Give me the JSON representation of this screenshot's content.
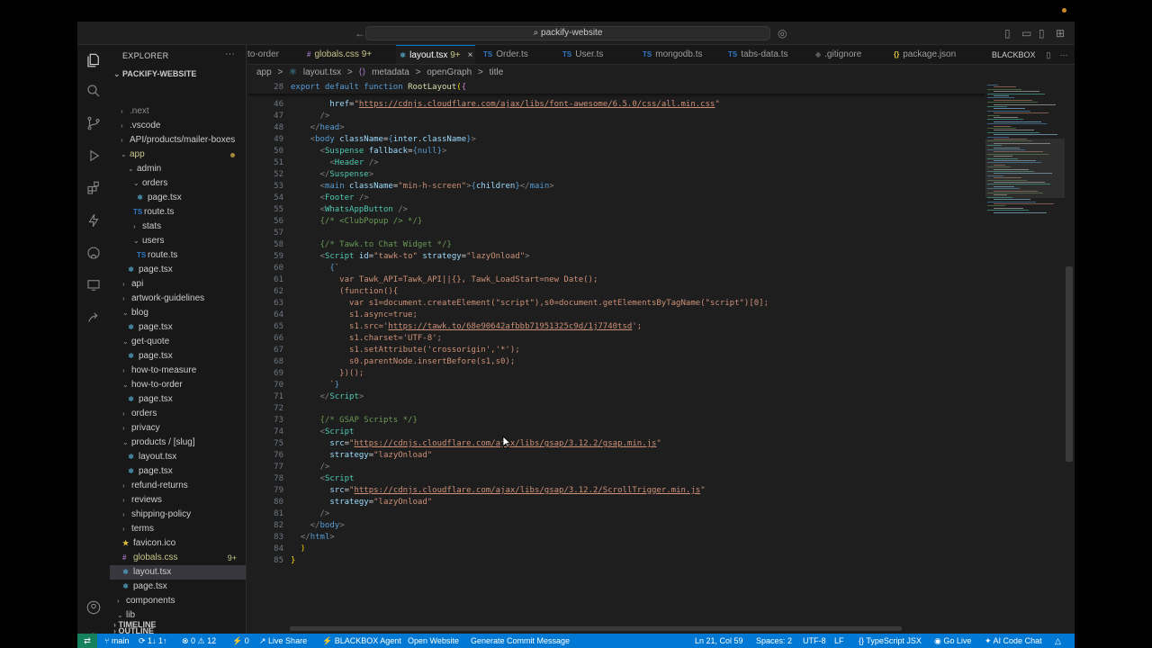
{
  "window": {
    "search": "packify-website",
    "nav_back": "←",
    "nav_fwd": "→"
  },
  "explorer": {
    "title": "EXPLORER",
    "more": "···",
    "root": "PACKIFY-WEBSITE",
    "items": [
      {
        "label": ".next"
      },
      {
        "label": ".vscode"
      },
      {
        "label": "API/products/mailer-boxes"
      },
      {
        "label": "app"
      },
      {
        "label": "admin"
      },
      {
        "label": "orders"
      },
      {
        "label": "page.tsx"
      },
      {
        "label": "route.ts"
      },
      {
        "label": "stats"
      },
      {
        "label": "users"
      },
      {
        "label": "route.ts"
      },
      {
        "label": "page.tsx"
      },
      {
        "label": "api"
      },
      {
        "label": "artwork-guidelines"
      },
      {
        "label": "blog"
      },
      {
        "label": "page.tsx"
      },
      {
        "label": "get-quote"
      },
      {
        "label": "page.tsx"
      },
      {
        "label": "how-to-measure"
      },
      {
        "label": "how-to-order"
      },
      {
        "label": "page.tsx"
      },
      {
        "label": "orders"
      },
      {
        "label": "privacy"
      },
      {
        "label": "products / [slug]"
      },
      {
        "label": "layout.tsx"
      },
      {
        "label": "page.tsx"
      },
      {
        "label": "refund-returns"
      },
      {
        "label": "reviews"
      },
      {
        "label": "shipping-policy"
      },
      {
        "label": "terms"
      },
      {
        "label": "favicon.ico"
      },
      {
        "label": "globals.css",
        "badge": "9+"
      },
      {
        "label": "layout.tsx"
      },
      {
        "label": "page.tsx"
      },
      {
        "label": "components"
      },
      {
        "label": "lib"
      }
    ],
    "outline": "OUTLINE",
    "timeline": "TIMELINE"
  },
  "tabs": [
    {
      "icon": "",
      "label": "to-order"
    },
    {
      "icon": "#",
      "label": "globals.css",
      "badge": "9+"
    },
    {
      "icon": "⚛",
      "label": "layout.tsx",
      "badge": "9+",
      "close": "×"
    },
    {
      "icon": "TS",
      "label": "Order.ts"
    },
    {
      "icon": "TS",
      "label": "User.ts"
    },
    {
      "icon": "TS",
      "label": "mongodb.ts"
    },
    {
      "icon": "TS",
      "label": "tabs-data.ts"
    },
    {
      "icon": "◆",
      "label": ".gitignore"
    },
    {
      "icon": "{}",
      "label": "package.json"
    }
  ],
  "blackbox_panel": "BLACKBOX",
  "breadcrumb": [
    "app",
    ">",
    "layout.tsx",
    ">",
    "metadata",
    ">",
    "openGraph",
    ">",
    "title"
  ],
  "code": {
    "sticky_line": "28",
    "sticky_text": "export default function RootLayout({",
    "line_numbers": [
      "46",
      "47",
      "48",
      "49",
      "50",
      "51",
      "52",
      "53",
      "54",
      "55",
      "56",
      "57",
      "58",
      "59",
      "60",
      "61",
      "62",
      "63",
      "64",
      "65",
      "66",
      "67",
      "68",
      "69",
      "70",
      "71",
      "72",
      "73",
      "74",
      "75",
      "76",
      "77",
      "78",
      "79",
      "80",
      "81",
      "82",
      "83",
      "84",
      "85"
    ]
  },
  "status_bar": {
    "remote": "⇄",
    "branch": "main",
    "sync": "⟳ 1↓ 1↑",
    "problems": "⊗ 0 ⚠ 12",
    "ports": "⚡ 0",
    "live_share": "Live Share",
    "blackbox_agent": "BLACKBOX Agent",
    "open_website": "Open Website",
    "commit_msg": "Generate Commit Message",
    "position": "Ln 21, Col 59",
    "spaces": "Spaces: 2",
    "encoding": "UTF-8",
    "eol": "LF",
    "language": "{} TypeScript JSX",
    "go_live": "Go Live",
    "ai_chat": "AI Code Chat",
    "bell": "🔔"
  },
  "colors": {
    "accent": "#0078d4",
    "remote": "#16825d"
  }
}
